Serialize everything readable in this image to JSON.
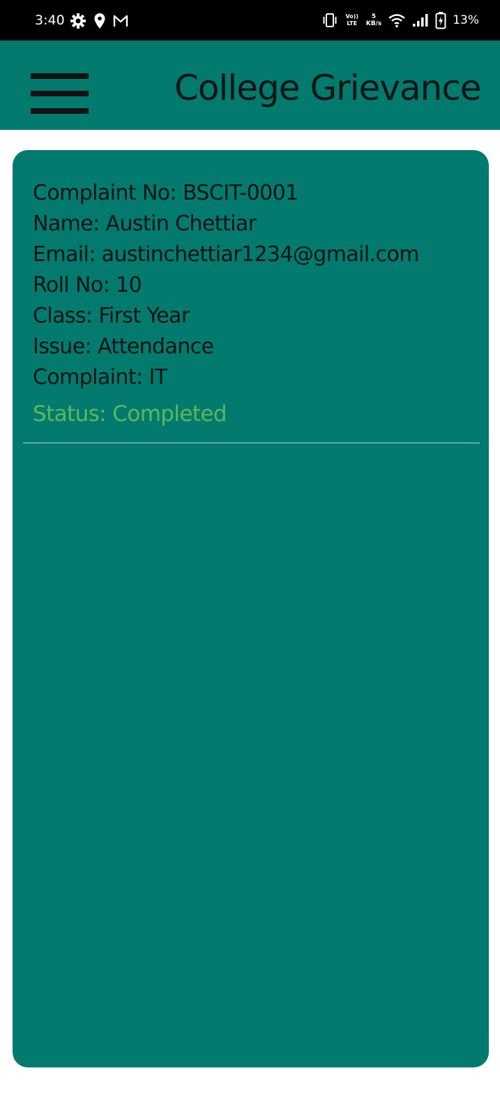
{
  "status_bar": {
    "time": "3:40",
    "volte_label": "Vo)) LTE",
    "net_speed_value": "5",
    "net_speed_unit": "KB/s",
    "battery_percent": "13%"
  },
  "app_bar": {
    "title": "College Grievance"
  },
  "complaint": {
    "complaint_no": "Complaint No: BSCIT-0001",
    "name": "Name: Austin Chettiar",
    "email": "Email: austinchettiar1234@gmail.com",
    "roll_no": "Roll No: 10",
    "class": "Class: First Year",
    "issue": "Issue: Attendance",
    "complaint": "Complaint: IT",
    "status": "Status: Completed"
  },
  "colors": {
    "primary": "#037a6e",
    "status_completed": "#5cb85c",
    "text": "#141414"
  },
  "icons": {
    "status_left": [
      "settings-gear-icon",
      "location-pin-icon",
      "gmail-icon"
    ],
    "status_right": [
      "vibrate-icon",
      "wifi-icon",
      "signal-icon",
      "battery-charging-icon"
    ],
    "app_bar": [
      "menu-icon"
    ]
  }
}
